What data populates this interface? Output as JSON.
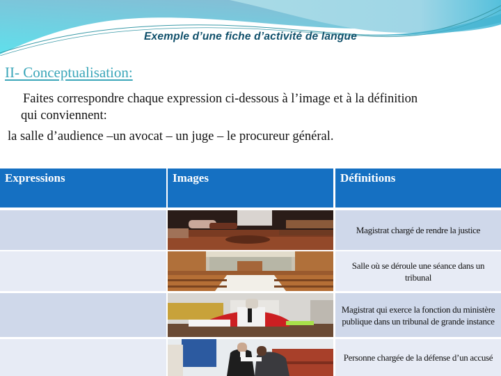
{
  "slide": {
    "title": "Exemple d’une fiche d’activité de langue",
    "section_heading": "II- Conceptualisation:",
    "instruction_line1": "Faites correspondre chaque expression ci-dessous à l’image et à la définition",
    "instruction_line2": "qui conviennent:",
    "word_list": "la salle d’audience –un  avocat – un juge – le procureur général."
  },
  "colors": {
    "header_bg": "#1570c2",
    "row_odd": "#cfd8ea",
    "row_even": "#e7ebf5",
    "title_color": "#0f4f6a",
    "heading_color": "#3aa6b9"
  },
  "table": {
    "headers": [
      "Expressions",
      "Images",
      "Définitions"
    ],
    "rows": [
      {
        "expression": "",
        "image": "judge-gavel-image",
        "definition": "Magistrat chargé de rendre la justice"
      },
      {
        "expression": "",
        "image": "courtroom-image",
        "definition": "Salle où se déroule une séance dans un tribunal"
      },
      {
        "expression": "",
        "image": "prosecutor-in-robes-image",
        "definition": "Magistrat qui exerce la fonction du ministère publique dans un tribunal de grande instance"
      },
      {
        "expression": "",
        "image": "lawyer-with-client-image",
        "definition": "Personne chargée de la défense d’un accusé"
      }
    ]
  }
}
